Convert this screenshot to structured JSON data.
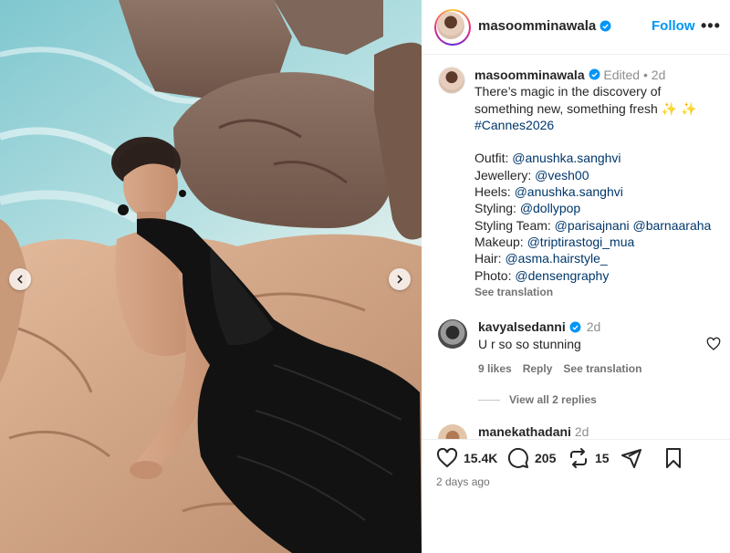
{
  "post": {
    "username": "masoomminawala",
    "follow_label": "Follow",
    "more_label": "•••"
  },
  "caption": {
    "username": "masoomminawala",
    "edited": "Edited",
    "dot": "•",
    "age": "2d",
    "text_line1": "There’s magic in the discovery of",
    "text_line2": "something new, something fresh",
    "sparkles": "✨ ✨",
    "hashtag": "#Cannes2026",
    "credits": [
      {
        "label": "Outfit:",
        "handles": "@anushka.sanghvi"
      },
      {
        "label": "Jewellery:",
        "handles": "@vesh00"
      },
      {
        "label": "Heels:",
        "handles": "@anushka.sanghvi"
      },
      {
        "label": "Styling:",
        "handles": "@dollypop"
      },
      {
        "label": "Styling Team:",
        "handles": "@parisajnani @barnaaraha"
      },
      {
        "label": "Makeup:",
        "handles": "@triptirastogi_mua"
      },
      {
        "label": "Hair:",
        "handles": "@asma.hairstyle_"
      },
      {
        "label": "Photo:",
        "handles": "@densengraphy"
      }
    ],
    "see_translation": "See translation"
  },
  "comments": [
    {
      "username": "kavyalsedanni",
      "age": "2d",
      "text": "U r so so stunning",
      "likes": "9 likes",
      "reply": "Reply",
      "see_translation": "See translation",
      "view_replies": "View all 2 replies"
    }
  ],
  "next_comment": {
    "username": "manekathadani",
    "age": "2d"
  },
  "actions": {
    "likes": "15.4K",
    "comments": "205",
    "reposts": "15"
  },
  "posted_time": "2 days ago",
  "colors": {
    "link": "#00376b",
    "follow": "#0095f6",
    "verified": "#0095f6",
    "muted": "#737373"
  },
  "icons": [
    "heart-icon",
    "comment-icon",
    "repost-icon",
    "share-icon",
    "bookmark-icon",
    "verified-icon",
    "chevron-left-icon",
    "chevron-right-icon"
  ]
}
